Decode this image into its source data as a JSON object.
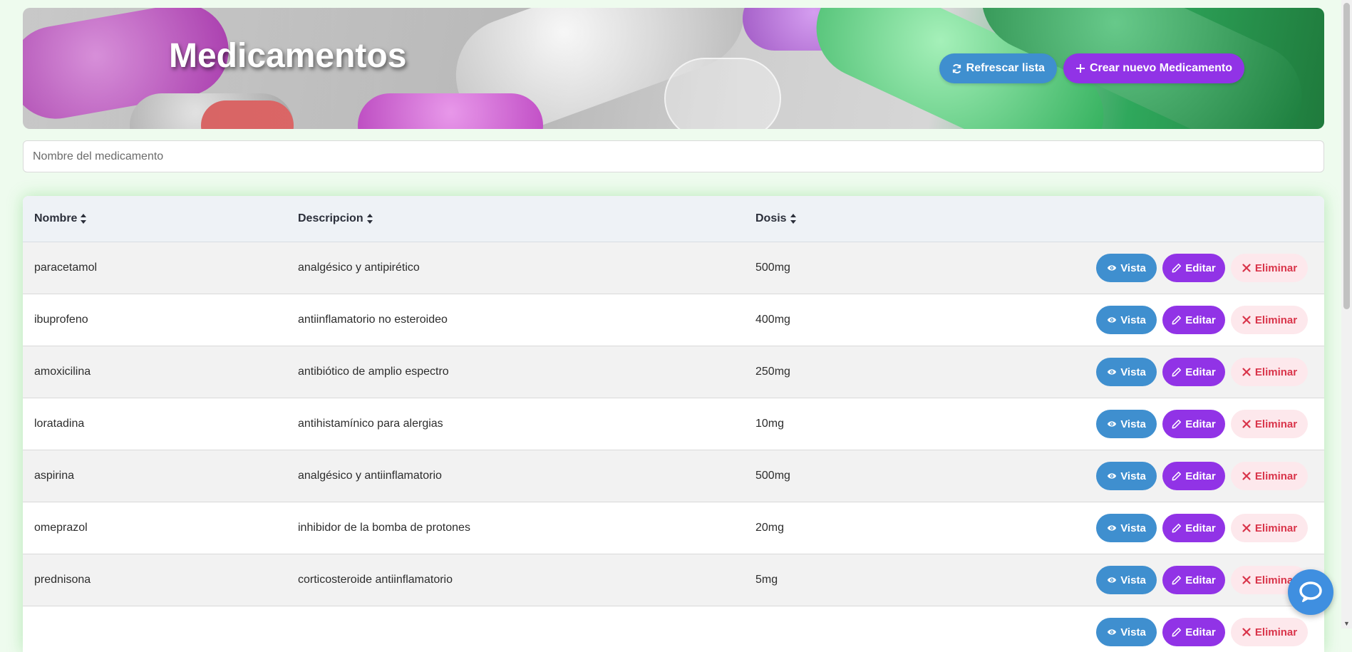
{
  "header": {
    "title": "Medicamentos",
    "refresh_label": "Refrescar lista",
    "create_label": "Crear nuevo Medicamento"
  },
  "search": {
    "placeholder": "Nombre del medicamento",
    "value": ""
  },
  "table": {
    "columns": [
      "Nombre",
      "Descripcion",
      "Dosis"
    ],
    "rows": [
      {
        "nombre": "paracetamol",
        "descripcion": "analgésico y antipirético",
        "dosis": "500mg"
      },
      {
        "nombre": "ibuprofeno",
        "descripcion": "antiinflamatorio no esteroideo",
        "dosis": "400mg"
      },
      {
        "nombre": "amoxicilina",
        "descripcion": "antibiótico de amplio espectro",
        "dosis": "250mg"
      },
      {
        "nombre": "loratadina",
        "descripcion": "antihistamínico para alergias",
        "dosis": "10mg"
      },
      {
        "nombre": "aspirina",
        "descripcion": "analgésico y antiinflamatorio",
        "dosis": "500mg"
      },
      {
        "nombre": "omeprazol",
        "descripcion": "inhibidor de la bomba de protones",
        "dosis": "20mg"
      },
      {
        "nombre": "prednisona",
        "descripcion": "corticosteroide antiinflamatorio",
        "dosis": "5mg"
      },
      {
        "nombre": "",
        "descripcion": "",
        "dosis": ""
      }
    ],
    "actions": {
      "view_label": "Vista",
      "edit_label": "Editar",
      "delete_label": "Eliminar"
    }
  },
  "colors": {
    "accent_blue": "#3f8fcf",
    "accent_purple": "#9133e6",
    "danger_text": "#d9344a",
    "danger_bg": "#fde8ec",
    "page_bg": "#eefbee"
  },
  "icons": {
    "refresh": "refresh-icon",
    "create": "plus-icon",
    "sort": "sort-icon",
    "view": "eye-icon",
    "edit": "pencil-icon",
    "delete": "close-icon",
    "chat": "chat-bubble-icon"
  }
}
